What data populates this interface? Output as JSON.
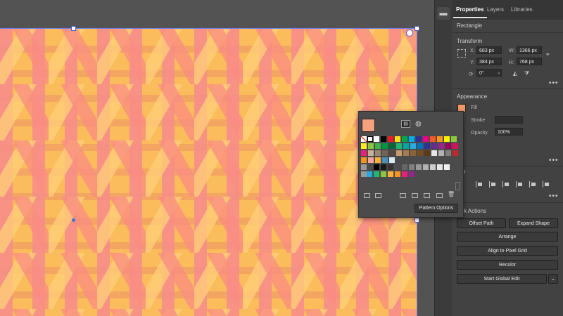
{
  "panel": {
    "tabs": [
      "Properties",
      "Layers",
      "Libraries"
    ],
    "object_type": "Rectangle",
    "transform": {
      "heading": "Transform",
      "x_label": "X:",
      "x_value": "683 px",
      "y_label": "Y:",
      "y_value": "384 px",
      "w_label": "W:",
      "w_value": "1366 px",
      "h_label": "H:",
      "h_value": "768 px",
      "rotation_value": "0°"
    },
    "appearance": {
      "heading": "Appearance",
      "fill_label": "Fill",
      "stroke_label": "Stroke",
      "opacity_label": "Opacity",
      "opacity_value": "100%"
    },
    "align_heading_fragment": "n",
    "quick_actions": {
      "heading": "ck Actions",
      "offset_path": "Offset Path",
      "expand_shape": "Expand Shape",
      "arrange": "Arrange",
      "align_pixel": "Align to Pixel Grid",
      "recolor": "Recolor",
      "global_edit": "Start Global Edit"
    },
    "more_glyph": "•••"
  },
  "swatches_popup": {
    "pattern_options": "Pattern Options",
    "colors": {
      "row1": [
        "#ffffff",
        "#000000",
        "#ed1c24",
        "#ffde17",
        "#00a651",
        "#00aeef",
        "#2e3192",
        "#ec008c",
        "#f15a24",
        "#f7941d",
        "#fff200",
        "#8dc63f"
      ],
      "row2": [
        "#fcee21",
        "#8cc63f",
        "#39b54a",
        "#009245",
        "#006837",
        "#22b573",
        "#00a99d",
        "#29abe2",
        "#0071bc",
        "#2e3192",
        "#662d91",
        "#93278f",
        "#9e005d",
        "#d4145a"
      ],
      "row3": [
        "#ed1e79",
        "#c7b299",
        "#998675",
        "#736357",
        "#534741",
        "#c69c6d",
        "#a67c52",
        "#8c6239",
        "#754c24",
        "#603813",
        "#e6e6e6",
        "#b3b3b3",
        "#808080",
        "#c1272d"
      ],
      "row4": [
        "#f7931e",
        "#f2a6a0",
        "#fbb03b",
        "#4a90b8",
        "#d9e7f2"
      ],
      "row5_grays": [
        "#000000",
        "#1a1a1a",
        "#333333",
        "#4d4d4d",
        "#666666",
        "#808080",
        "#999999",
        "#b3b3b3",
        "#cccccc",
        "#e6e6e6",
        "#f2f2f2"
      ],
      "row6": [
        "#29abe2",
        "#22b573",
        "#8cc63f",
        "#fbb03b",
        "#f7931e",
        "#ed1e79",
        "#93278f"
      ]
    }
  },
  "artboard": {
    "fill_a": "#fbbd5c",
    "fill_b": "#f78f87"
  }
}
